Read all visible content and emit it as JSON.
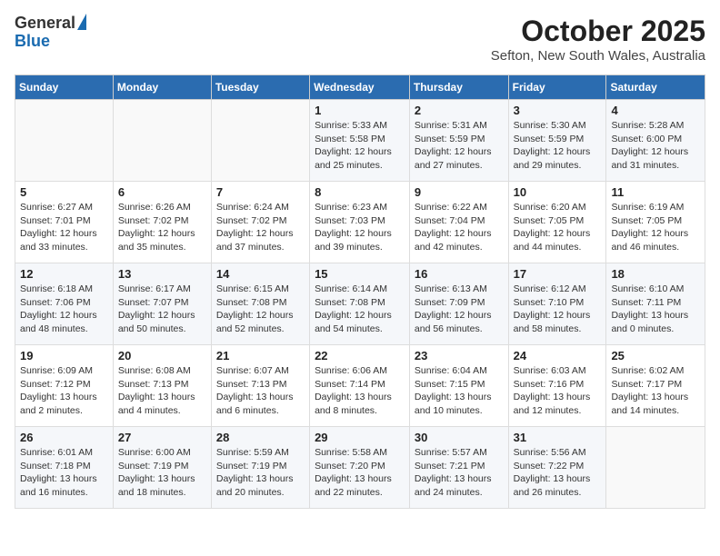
{
  "logo": {
    "general": "General",
    "blue": "Blue"
  },
  "title": "October 2025",
  "subtitle": "Sefton, New South Wales, Australia",
  "days_of_week": [
    "Sunday",
    "Monday",
    "Tuesday",
    "Wednesday",
    "Thursday",
    "Friday",
    "Saturday"
  ],
  "weeks": [
    [
      {
        "day": "",
        "info": ""
      },
      {
        "day": "",
        "info": ""
      },
      {
        "day": "",
        "info": ""
      },
      {
        "day": "1",
        "info": "Sunrise: 5:33 AM\nSunset: 5:58 PM\nDaylight: 12 hours\nand 25 minutes."
      },
      {
        "day": "2",
        "info": "Sunrise: 5:31 AM\nSunset: 5:59 PM\nDaylight: 12 hours\nand 27 minutes."
      },
      {
        "day": "3",
        "info": "Sunrise: 5:30 AM\nSunset: 5:59 PM\nDaylight: 12 hours\nand 29 minutes."
      },
      {
        "day": "4",
        "info": "Sunrise: 5:28 AM\nSunset: 6:00 PM\nDaylight: 12 hours\nand 31 minutes."
      }
    ],
    [
      {
        "day": "5",
        "info": "Sunrise: 6:27 AM\nSunset: 7:01 PM\nDaylight: 12 hours\nand 33 minutes."
      },
      {
        "day": "6",
        "info": "Sunrise: 6:26 AM\nSunset: 7:02 PM\nDaylight: 12 hours\nand 35 minutes."
      },
      {
        "day": "7",
        "info": "Sunrise: 6:24 AM\nSunset: 7:02 PM\nDaylight: 12 hours\nand 37 minutes."
      },
      {
        "day": "8",
        "info": "Sunrise: 6:23 AM\nSunset: 7:03 PM\nDaylight: 12 hours\nand 39 minutes."
      },
      {
        "day": "9",
        "info": "Sunrise: 6:22 AM\nSunset: 7:04 PM\nDaylight: 12 hours\nand 42 minutes."
      },
      {
        "day": "10",
        "info": "Sunrise: 6:20 AM\nSunset: 7:05 PM\nDaylight: 12 hours\nand 44 minutes."
      },
      {
        "day": "11",
        "info": "Sunrise: 6:19 AM\nSunset: 7:05 PM\nDaylight: 12 hours\nand 46 minutes."
      }
    ],
    [
      {
        "day": "12",
        "info": "Sunrise: 6:18 AM\nSunset: 7:06 PM\nDaylight: 12 hours\nand 48 minutes."
      },
      {
        "day": "13",
        "info": "Sunrise: 6:17 AM\nSunset: 7:07 PM\nDaylight: 12 hours\nand 50 minutes."
      },
      {
        "day": "14",
        "info": "Sunrise: 6:15 AM\nSunset: 7:08 PM\nDaylight: 12 hours\nand 52 minutes."
      },
      {
        "day": "15",
        "info": "Sunrise: 6:14 AM\nSunset: 7:08 PM\nDaylight: 12 hours\nand 54 minutes."
      },
      {
        "day": "16",
        "info": "Sunrise: 6:13 AM\nSunset: 7:09 PM\nDaylight: 12 hours\nand 56 minutes."
      },
      {
        "day": "17",
        "info": "Sunrise: 6:12 AM\nSunset: 7:10 PM\nDaylight: 12 hours\nand 58 minutes."
      },
      {
        "day": "18",
        "info": "Sunrise: 6:10 AM\nSunset: 7:11 PM\nDaylight: 13 hours\nand 0 minutes."
      }
    ],
    [
      {
        "day": "19",
        "info": "Sunrise: 6:09 AM\nSunset: 7:12 PM\nDaylight: 13 hours\nand 2 minutes."
      },
      {
        "day": "20",
        "info": "Sunrise: 6:08 AM\nSunset: 7:13 PM\nDaylight: 13 hours\nand 4 minutes."
      },
      {
        "day": "21",
        "info": "Sunrise: 6:07 AM\nSunset: 7:13 PM\nDaylight: 13 hours\nand 6 minutes."
      },
      {
        "day": "22",
        "info": "Sunrise: 6:06 AM\nSunset: 7:14 PM\nDaylight: 13 hours\nand 8 minutes."
      },
      {
        "day": "23",
        "info": "Sunrise: 6:04 AM\nSunset: 7:15 PM\nDaylight: 13 hours\nand 10 minutes."
      },
      {
        "day": "24",
        "info": "Sunrise: 6:03 AM\nSunset: 7:16 PM\nDaylight: 13 hours\nand 12 minutes."
      },
      {
        "day": "25",
        "info": "Sunrise: 6:02 AM\nSunset: 7:17 PM\nDaylight: 13 hours\nand 14 minutes."
      }
    ],
    [
      {
        "day": "26",
        "info": "Sunrise: 6:01 AM\nSunset: 7:18 PM\nDaylight: 13 hours\nand 16 minutes."
      },
      {
        "day": "27",
        "info": "Sunrise: 6:00 AM\nSunset: 7:19 PM\nDaylight: 13 hours\nand 18 minutes."
      },
      {
        "day": "28",
        "info": "Sunrise: 5:59 AM\nSunset: 7:19 PM\nDaylight: 13 hours\nand 20 minutes."
      },
      {
        "day": "29",
        "info": "Sunrise: 5:58 AM\nSunset: 7:20 PM\nDaylight: 13 hours\nand 22 minutes."
      },
      {
        "day": "30",
        "info": "Sunrise: 5:57 AM\nSunset: 7:21 PM\nDaylight: 13 hours\nand 24 minutes."
      },
      {
        "day": "31",
        "info": "Sunrise: 5:56 AM\nSunset: 7:22 PM\nDaylight: 13 hours\nand 26 minutes."
      },
      {
        "day": "",
        "info": ""
      }
    ]
  ]
}
